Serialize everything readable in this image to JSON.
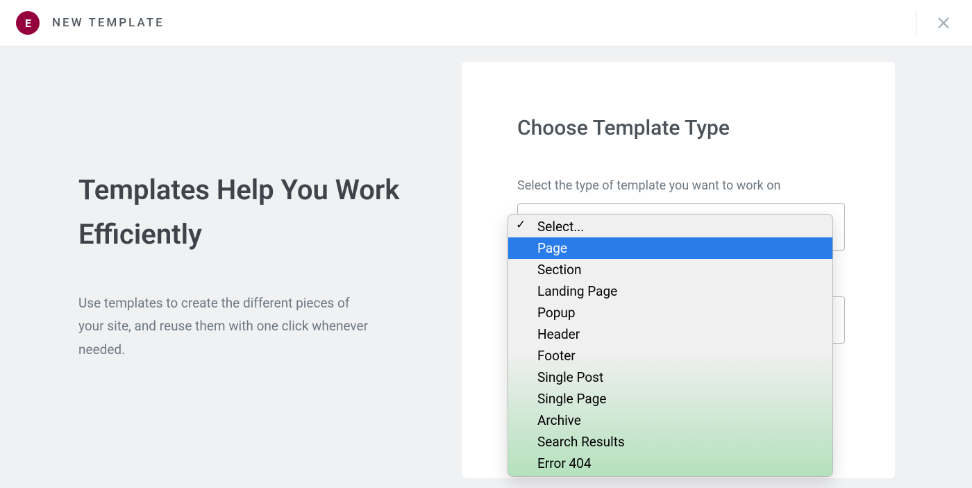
{
  "header": {
    "logo_text": "E",
    "title": "NEW TEMPLATE"
  },
  "left": {
    "heading": "Templates Help You Work Efficiently",
    "description": "Use templates to create the different pieces of your site, and reuse them with one click whenever needed."
  },
  "card": {
    "title": "Choose Template Type",
    "label": "Select the type of template you want to work on"
  },
  "dropdown": {
    "selected": "Select...",
    "highlighted_index": 1,
    "options": [
      "Select...",
      "Page",
      "Section",
      "Landing Page",
      "Popup",
      "Header",
      "Footer",
      "Single Post",
      "Single Page",
      "Archive",
      "Search Results",
      "Error 404"
    ]
  }
}
